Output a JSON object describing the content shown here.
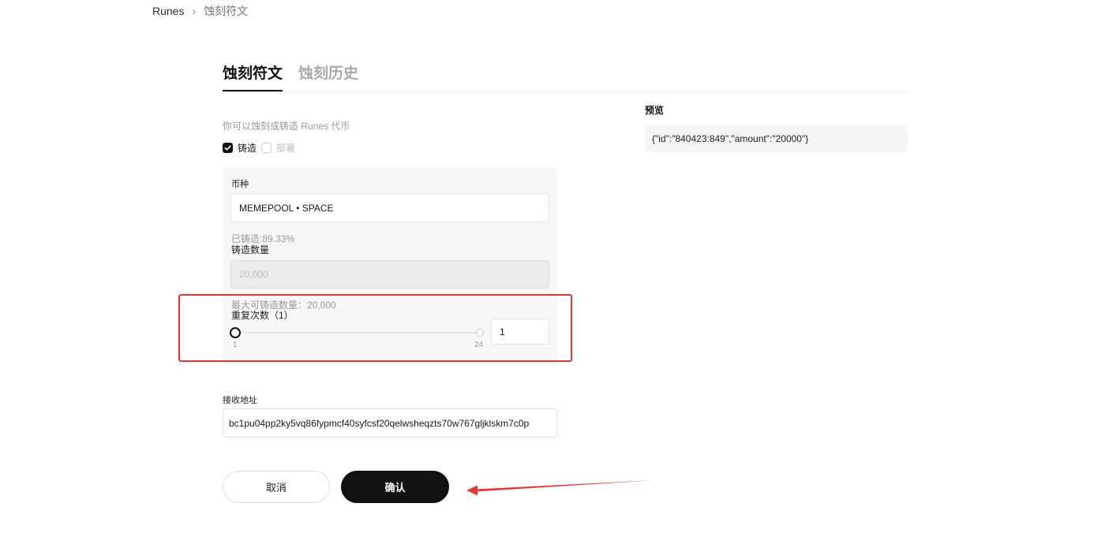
{
  "breadcrumb": {
    "root": "Runes",
    "separator": "›",
    "current": "蚀刻符文"
  },
  "tabs": [
    {
      "label": "蚀刻符文",
      "active": true
    },
    {
      "label": "蚀刻历史",
      "active": false
    }
  ],
  "form": {
    "intro": "你可以蚀刻或铸造 Runes 代币",
    "mode_options": [
      {
        "label": "铸造",
        "checked": true
      },
      {
        "label": "部署",
        "checked": false
      }
    ],
    "token": {
      "label": "币种",
      "value": "MEMEPOOL • SPACE",
      "minted": "已铸造:89.33%"
    },
    "amount": {
      "label": "铸造数量",
      "value": "20,000",
      "max_text": "最大可铸造数量：20,000"
    },
    "repeat": {
      "label": "重复次数（1）",
      "min_label": "1",
      "max_label": "24",
      "slider_min": 1,
      "slider_max": 24,
      "slider_value": 1,
      "input_value": "1"
    },
    "address": {
      "label": "接收地址",
      "value": "bc1pu04pp2ky5vq86fypmcf40syfcsf20qelwsheqzts70w767gljklskm7c0p"
    },
    "cancel_label": "取消",
    "confirm_label": "确认"
  },
  "preview": {
    "title": "预览",
    "content": "{\"id\":\"840423:849\",\"amount\":\"20000\"}"
  },
  "colors": {
    "accent": "#111111",
    "annotation": "#e53935",
    "card": "#f7f7f7"
  }
}
